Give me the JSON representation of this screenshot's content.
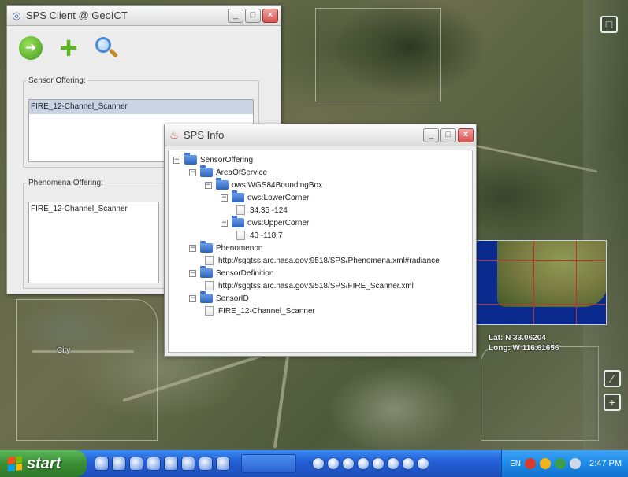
{
  "map": {
    "city_label": "City",
    "coords": {
      "lat": "Lat:  N 33.06204",
      "long": "Long: W 116.61656"
    }
  },
  "client_window": {
    "title": "SPS Client @ GeoICT",
    "sensor_offering": {
      "legend": "Sensor Offering:",
      "items": [
        "FIRE_12-Channel_Scanner"
      ]
    },
    "phenomena_offering": {
      "legend": "Phenomena Offering:",
      "items": [
        "FIRE_12-Channel_Scanner"
      ]
    }
  },
  "info_window": {
    "title": "SPS Info",
    "tree": [
      {
        "label": "SensorOffering",
        "type": "folder",
        "depth": 0
      },
      {
        "label": "AreaOfService",
        "type": "folder",
        "depth": 1
      },
      {
        "label": "ows:WGS84BoundingBox",
        "type": "folder",
        "depth": 2
      },
      {
        "label": "ows:LowerCorner",
        "type": "folder",
        "depth": 3
      },
      {
        "label": "34.35 -124",
        "type": "leaf",
        "depth": 4
      },
      {
        "label": "ows:UpperCorner",
        "type": "folder",
        "depth": 3
      },
      {
        "label": "40 -118.7",
        "type": "leaf",
        "depth": 4
      },
      {
        "label": "Phenomenon",
        "type": "folder",
        "depth": 1
      },
      {
        "label": "http://sgqtss.arc.nasa.gov:9518/SPS/Phenomena.xml#radiance",
        "type": "leaf",
        "depth": 2
      },
      {
        "label": "SensorDefinition",
        "type": "folder",
        "depth": 1
      },
      {
        "label": "http://sgqtss.arc.nasa.gov:9518/SPS/FIRE_Scanner.xml",
        "type": "leaf",
        "depth": 2
      },
      {
        "label": "SensorID",
        "type": "folder",
        "depth": 1
      },
      {
        "label": "FIRE_12-Channel_Scanner",
        "type": "leaf",
        "depth": 2
      }
    ]
  },
  "taskbar": {
    "start_label": "start",
    "language": "EN",
    "clock": "2:47 PM"
  },
  "colors": {
    "taskbar": "#2460d8",
    "start": "#3a8d34",
    "selection": "#c9d3e6",
    "overview_water": "#0b2a8e"
  }
}
